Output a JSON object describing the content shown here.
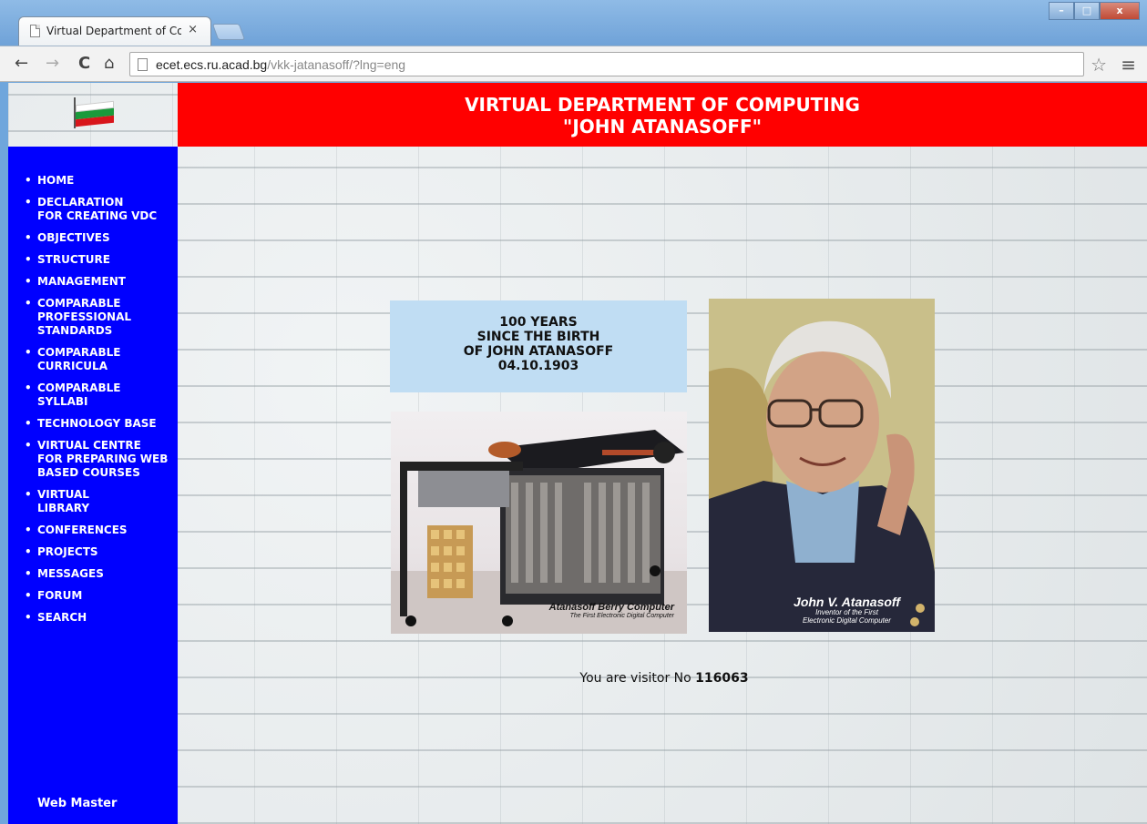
{
  "browser": {
    "tab_title": "Virtual Department of Com",
    "tab_close": "×",
    "url_host": "ecet.ecs.ru.acad.bg",
    "url_path": "/vkk-jatanasoff/?lng=eng",
    "window_controls": {
      "minimize": "–",
      "maximize": "□",
      "close": "x"
    },
    "nav": {
      "back": "←",
      "forward": "→",
      "reload": "C",
      "home": "⌂"
    },
    "bookmark_star": "☆",
    "menu": "≡"
  },
  "header": {
    "title_line1": "VIRTUAL DEPARTMENT OF COMPUTING",
    "title_line2": "\"JOHN ATANASOFF\""
  },
  "sidebar": {
    "items": [
      "HOME",
      "DECLARATION\nFOR CREATING VDC",
      "OBJECTIVES",
      "STRUCTURE",
      "MANAGEMENT",
      "COMPARABLE\nPROFESSIONAL\nSTANDARDS",
      "COMPARABLE\nCURRICULA",
      "COMPARABLE\nSYLLABI",
      "TECHNOLOGY BASE",
      "VIRTUAL CENTRE\nFOR PREPARING WEB\nBASED COURSES",
      "VIRTUAL\nLIBRARY",
      "CONFERENCES",
      "PROJECTS",
      "MESSAGES",
      "FORUM",
      "SEARCH"
    ],
    "footer": "Web Master"
  },
  "banner": {
    "line1": "100 YEARS",
    "line2": "SINCE THE BIRTH",
    "line3": "OF JOHN ATANASOFF",
    "line4": "04.10.1903"
  },
  "photos": {
    "computer_caption": "Atanasoff Berry Computer",
    "computer_subcaption": "The First Electronic Digital Computer",
    "portrait_caption": "John V. Atanasoff",
    "portrait_subcaption_1": "Inventor of the First",
    "portrait_subcaption_2": "Electronic Digital Computer"
  },
  "visitor": {
    "label": "You are visitor No",
    "count": "116063"
  },
  "colors": {
    "sidebar": "#0000ff",
    "header": "#ff0000",
    "banner": "#c0ddf3"
  }
}
